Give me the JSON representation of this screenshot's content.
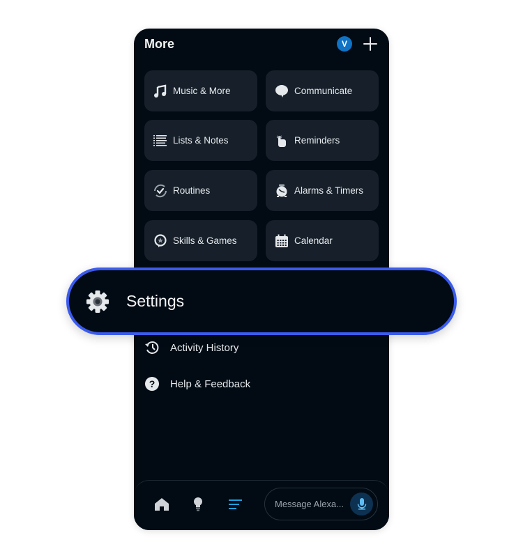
{
  "header": {
    "title": "More",
    "avatar_initial": "V",
    "avatar_color": "#0f73c6",
    "add_icon": "plus-icon"
  },
  "tiles": [
    {
      "label": "Music & More",
      "icon": "music-note-icon"
    },
    {
      "label": "Communicate",
      "icon": "speech-bubble-icon"
    },
    {
      "label": "Lists & Notes",
      "icon": "list-icon"
    },
    {
      "label": "Reminders",
      "icon": "finger-string-icon"
    },
    {
      "label": "Routines",
      "icon": "routine-check-icon"
    },
    {
      "label": "Alarms & Timers",
      "icon": "alarm-clock-icon"
    },
    {
      "label": "Skills & Games",
      "icon": "star-bubble-icon"
    },
    {
      "label": "Calendar",
      "icon": "calendar-icon"
    }
  ],
  "settings": {
    "label": "Settings",
    "icon": "gear-icon",
    "highlight_color": "#3b5bed"
  },
  "list": [
    {
      "label": "Activity History",
      "icon": "history-icon"
    },
    {
      "label": "Help & Feedback",
      "icon": "help-icon"
    }
  ],
  "bottom_nav": {
    "items": [
      {
        "name": "home",
        "icon": "home-icon",
        "active": false
      },
      {
        "name": "devices",
        "icon": "lightbulb-icon",
        "active": false
      },
      {
        "name": "more",
        "icon": "menu-icon",
        "active": true
      }
    ],
    "active_color": "#1ba1e2",
    "message_placeholder": "Message Alexa...",
    "mic_icon": "microphone-icon"
  }
}
